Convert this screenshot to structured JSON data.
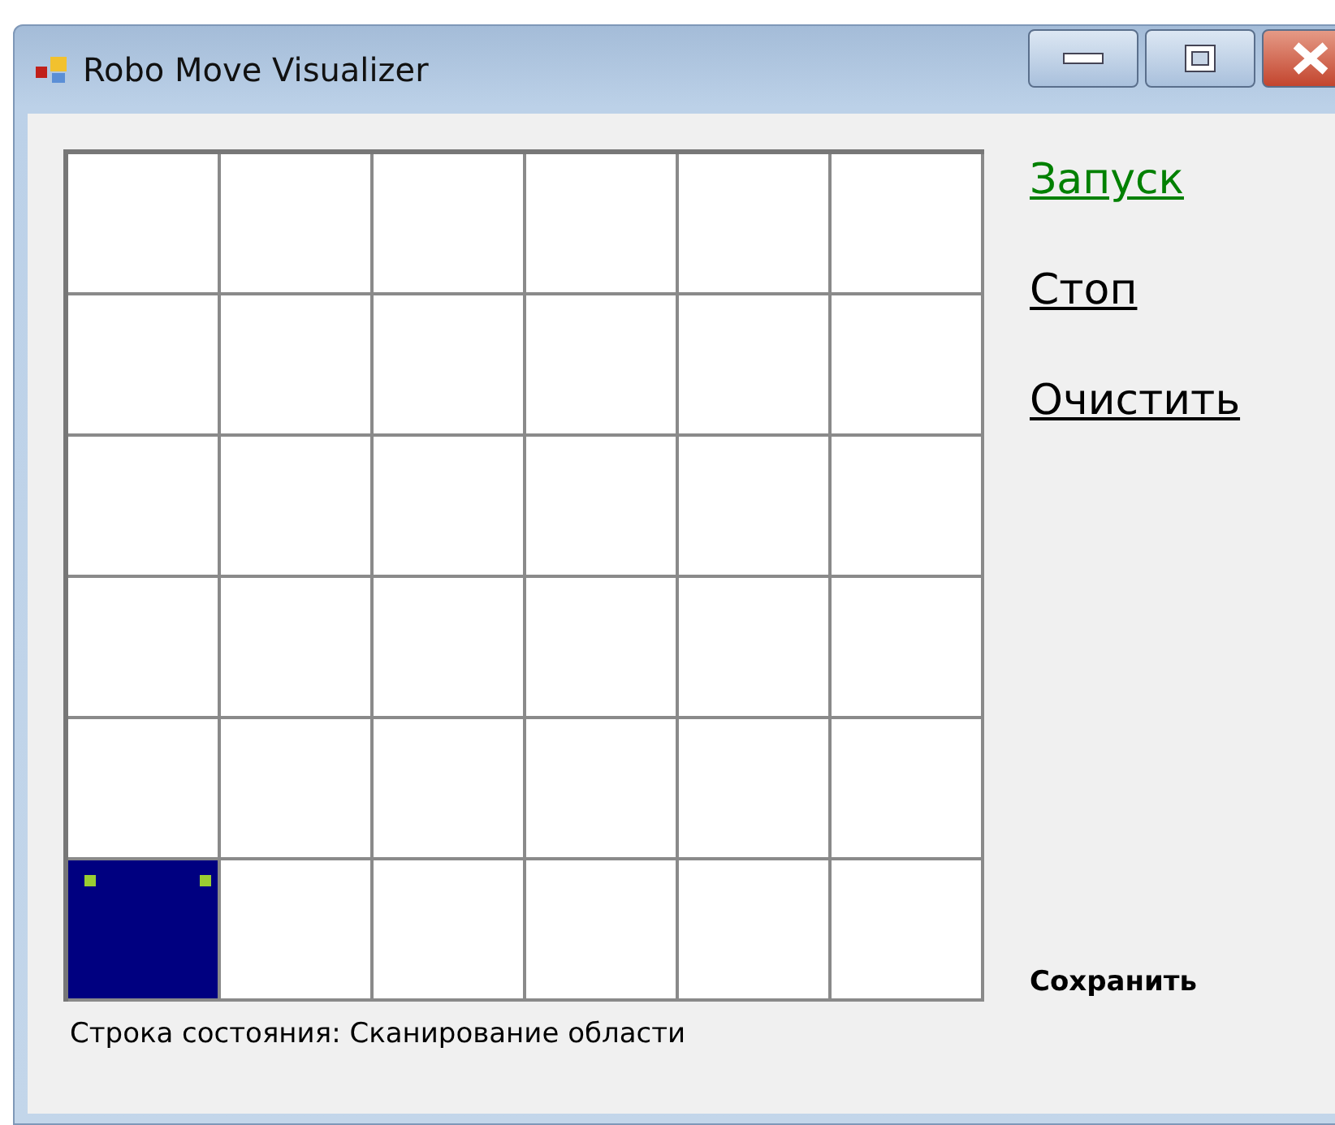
{
  "window": {
    "title": "Robo Move Visualizer"
  },
  "grid": {
    "rows": [
      [
        {
          "robot": false
        },
        {
          "robot": false
        },
        {
          "robot": false
        },
        {
          "robot": false
        },
        {
          "robot": false
        },
        {
          "robot": false
        }
      ],
      [
        {
          "robot": false
        },
        {
          "robot": false
        },
        {
          "robot": false
        },
        {
          "robot": false
        },
        {
          "robot": false
        },
        {
          "robot": false
        }
      ],
      [
        {
          "robot": false
        },
        {
          "robot": false
        },
        {
          "robot": false
        },
        {
          "robot": false
        },
        {
          "robot": false
        },
        {
          "robot": false
        }
      ],
      [
        {
          "robot": false
        },
        {
          "robot": false
        },
        {
          "robot": false
        },
        {
          "robot": false
        },
        {
          "robot": false
        },
        {
          "robot": false
        }
      ],
      [
        {
          "robot": false
        },
        {
          "robot": false
        },
        {
          "robot": false
        },
        {
          "robot": false
        },
        {
          "robot": false
        },
        {
          "robot": false
        }
      ],
      [
        {
          "robot": true
        },
        {
          "robot": false
        },
        {
          "robot": false
        },
        {
          "robot": false
        },
        {
          "robot": false
        },
        {
          "robot": false
        }
      ]
    ]
  },
  "links": [
    {
      "label": "Запуск",
      "color": "#008000"
    },
    {
      "label": "Стоп",
      "color": "#000000"
    },
    {
      "label": "Очистить",
      "color": "#000000"
    }
  ],
  "save_button": "Сохранить",
  "status_bar": "Строка состояния: Сканирование области"
}
